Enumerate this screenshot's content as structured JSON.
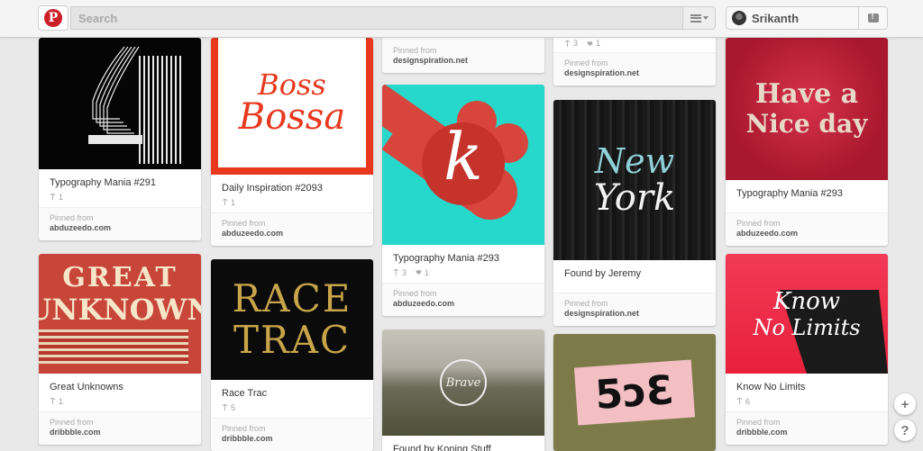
{
  "header": {
    "search_placeholder": "Search",
    "user_name": "Srikanth",
    "brand_color": "#cb2027"
  },
  "pins": [
    {
      "col": 0,
      "description": "Typography Mania #291",
      "repins": "1",
      "likes": "",
      "credits_label": "Pinned from",
      "source": "abduzeedo.com"
    },
    {
      "col": 0,
      "description": "Great Unknowns",
      "repins": "1",
      "likes": "",
      "credits_label": "Pinned from",
      "source": "dribbble.com"
    },
    {
      "col": 1,
      "description": "Daily Inspiration #2093",
      "repins": "1",
      "likes": "",
      "credits_label": "Pinned from",
      "source": "abduzeedo.com"
    },
    {
      "col": 1,
      "description": "Race Trac",
      "repins": "5",
      "likes": "",
      "credits_label": "Pinned from",
      "source": "dribbble.com"
    },
    {
      "col": 2,
      "description": "",
      "repins": "",
      "likes": "",
      "credits_label": "Pinned from",
      "source": "designspiration.net"
    },
    {
      "col": 2,
      "description": "Typography Mania #293",
      "repins": "3",
      "likes": "1",
      "credits_label": "Pinned from",
      "source": "abduzeedo.com"
    },
    {
      "col": 2,
      "description": "Found by Koning Stuff",
      "repins": "",
      "likes": "",
      "credits_label": "",
      "source": ""
    },
    {
      "col": 3,
      "description": "",
      "repins": "3",
      "likes": "1",
      "credits_label": "Pinned from",
      "source": "designspiration.net"
    },
    {
      "col": 3,
      "description": "Found by Jeremy",
      "repins": "",
      "likes": "",
      "credits_label": "Pinned from",
      "source": "designspiration.net"
    },
    {
      "col": 4,
      "description": "Typography Mania #293",
      "repins": "",
      "likes": "",
      "credits_label": "Pinned from",
      "source": "abduzeedo.com"
    },
    {
      "col": 4,
      "description": "Know No Limits",
      "repins": "6",
      "likes": "",
      "credits_label": "Pinned from",
      "source": "dribbble.com"
    }
  ],
  "artwork": {
    "great_unknown_line1": "GREAT",
    "great_unknown_line2": "UNKNOWN",
    "boss_line1": "Boss",
    "boss_line2": "Bossa",
    "race_line1": "RACE",
    "race_line2": "TRAC",
    "k_glyph": "k",
    "new_york_line1": "New",
    "new_york_line2": "York",
    "brave_text": "Brave",
    "love_text": "5ↄƐ",
    "nice_day_line1": "Have a",
    "nice_day_line2": "Nice day",
    "know_line1": "Know",
    "know_line2": "No Limits"
  },
  "fab": {
    "add_label": "+",
    "help_label": "?"
  }
}
